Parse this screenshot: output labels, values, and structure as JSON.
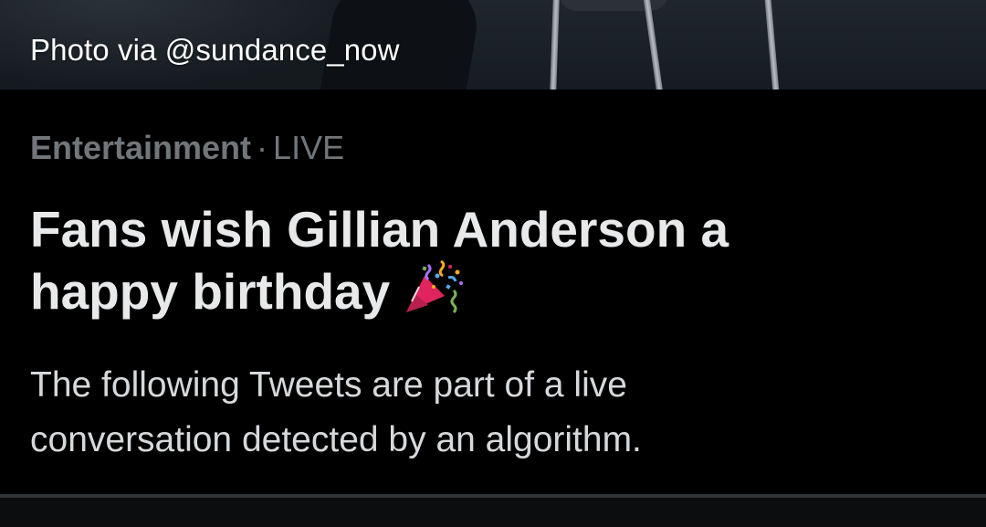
{
  "photo": {
    "caption": "Photo via @sundance_now"
  },
  "event": {
    "category": "Entertainment",
    "separator": "·",
    "status": "LIVE",
    "headline_line1": "Fans wish Gillian Anderson a",
    "headline_line2": "happy birthday",
    "headline_icon": "party-popper-icon",
    "description_line1": "The following Tweets are part of a live",
    "description_line2": "conversation detected by an algorithm."
  },
  "colors": {
    "background": "#000000",
    "secondary_text": "#71767b",
    "primary_text": "#e7e9ea",
    "divider": "#2f3336"
  }
}
